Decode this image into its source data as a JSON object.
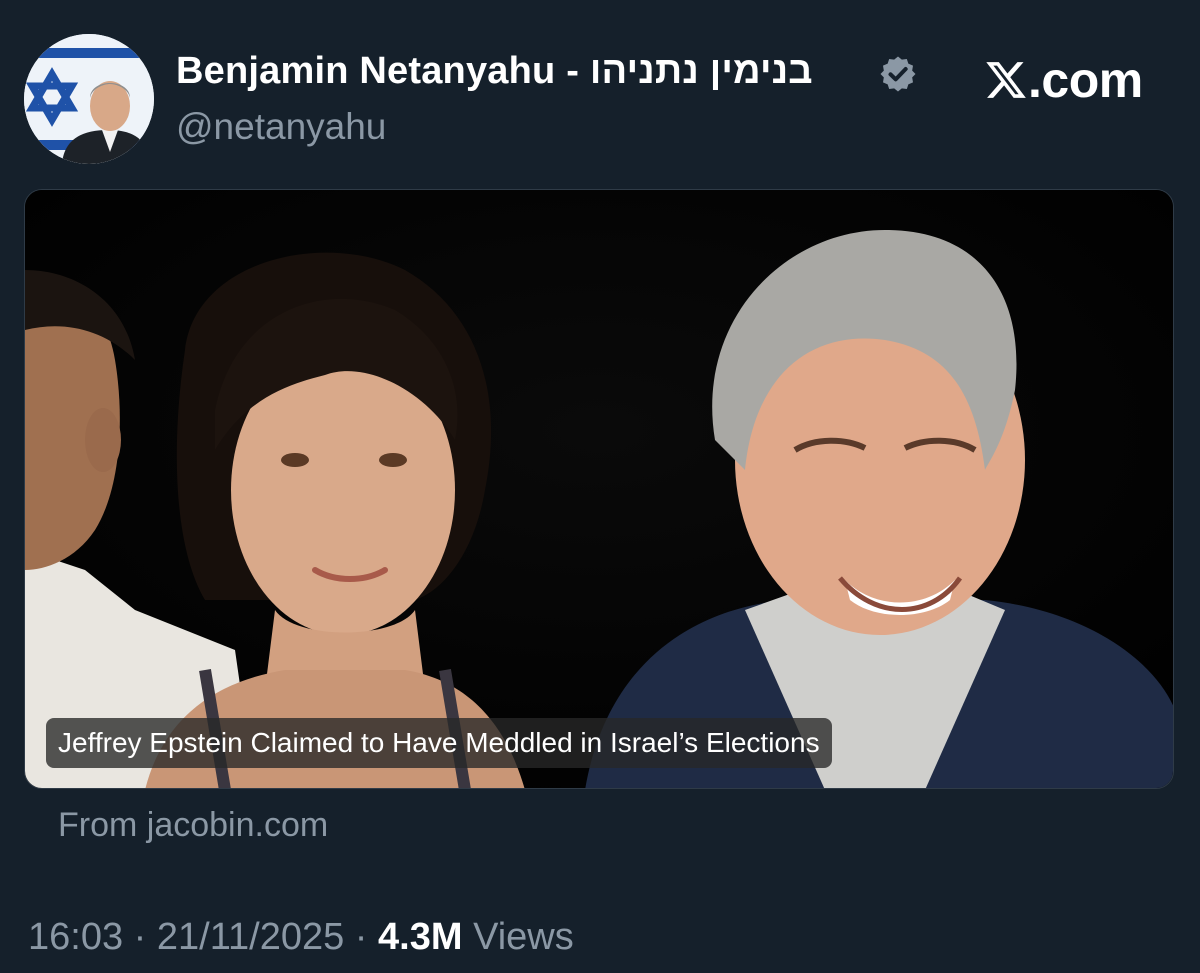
{
  "author": {
    "display_name": "Benjamin Netanyahu - בנימין נתניהו",
    "handle": "@netanyahu",
    "verified_icon": "verified-badge-icon"
  },
  "brand": {
    "text": ".com",
    "icon": "x-logo-icon"
  },
  "link_card": {
    "headline": "Jeffrey Epstein Claimed to Have Meddled in Israel’s Elections",
    "source": "From jacobin.com"
  },
  "meta": {
    "time": "16:03",
    "date": "21/11/2025",
    "separator": " · ",
    "views_count": "4.3M",
    "views_label": " Views"
  },
  "colors": {
    "background": "#15202b",
    "secondary_text": "#8b98a5",
    "primary_text": "#ffffff",
    "verified_badge": "#8b98a5"
  }
}
